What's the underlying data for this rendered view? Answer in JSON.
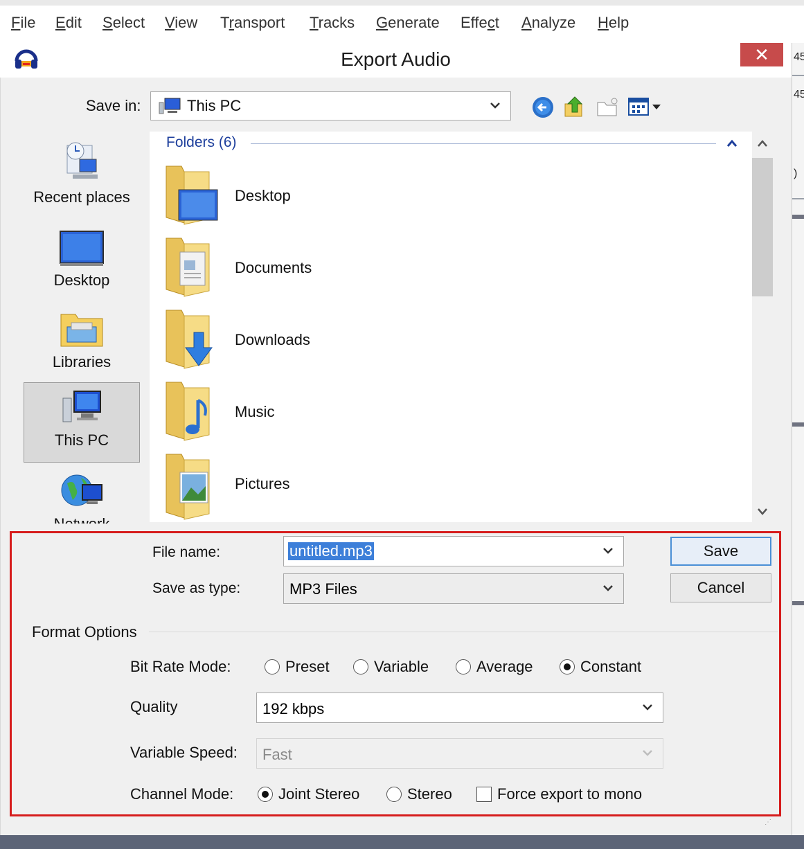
{
  "menubar": {
    "items": [
      {
        "pre": "",
        "u": "F",
        "post": "ile"
      },
      {
        "pre": "",
        "u": "E",
        "post": "dit"
      },
      {
        "pre": "",
        "u": "S",
        "post": "elect"
      },
      {
        "pre": "",
        "u": "V",
        "post": "iew"
      },
      {
        "pre": "T",
        "u": "r",
        "post": "ansport"
      },
      {
        "pre": "",
        "u": "T",
        "post": "racks"
      },
      {
        "pre": "",
        "u": "G",
        "post": "enerate"
      },
      {
        "pre": "Effe",
        "u": "c",
        "post": "t"
      },
      {
        "pre": "",
        "u": "A",
        "post": "nalyze"
      },
      {
        "pre": "",
        "u": "H",
        "post": "elp"
      }
    ]
  },
  "app_edge": {
    "t1": "45",
    "t2": "45",
    "t3": ")"
  },
  "dialog": {
    "title": "Export Audio",
    "close_glyph": "✕",
    "save_in_label": "Save in:",
    "save_in_value": "This PC",
    "places": {
      "recent": "Recent places",
      "desktop": "Desktop",
      "libraries": "Libraries",
      "thispc": "This PC",
      "network": "Network"
    },
    "folders_header": "Folders (6)",
    "folders": [
      "Desktop",
      "Documents",
      "Downloads",
      "Music",
      "Pictures"
    ],
    "file_name_label": "File name:",
    "file_name_value": "untitled.mp3",
    "save_as_type_label": "Save as type:",
    "save_as_type_value": "MP3 Files",
    "save_button": "Save",
    "cancel_button": "Cancel",
    "format_options": {
      "title": "Format Options",
      "bit_rate_label": "Bit Rate Mode:",
      "bit_rate_options": [
        "Preset",
        "Variable",
        "Average",
        "Constant"
      ],
      "bit_rate_selected": "Constant",
      "quality_label": "Quality",
      "quality_value": "192 kbps",
      "variable_speed_label": "Variable Speed:",
      "variable_speed_value": "Fast",
      "channel_mode_label": "Channel Mode:",
      "channel_options": [
        "Joint Stereo",
        "Stereo"
      ],
      "channel_selected": "Joint Stereo",
      "force_mono_label": "Force export to mono",
      "force_mono_checked": false
    }
  },
  "colors": {
    "highlight": "#d61c1c",
    "link_blue": "#1e3f9c",
    "close_red": "#c74b4b"
  }
}
